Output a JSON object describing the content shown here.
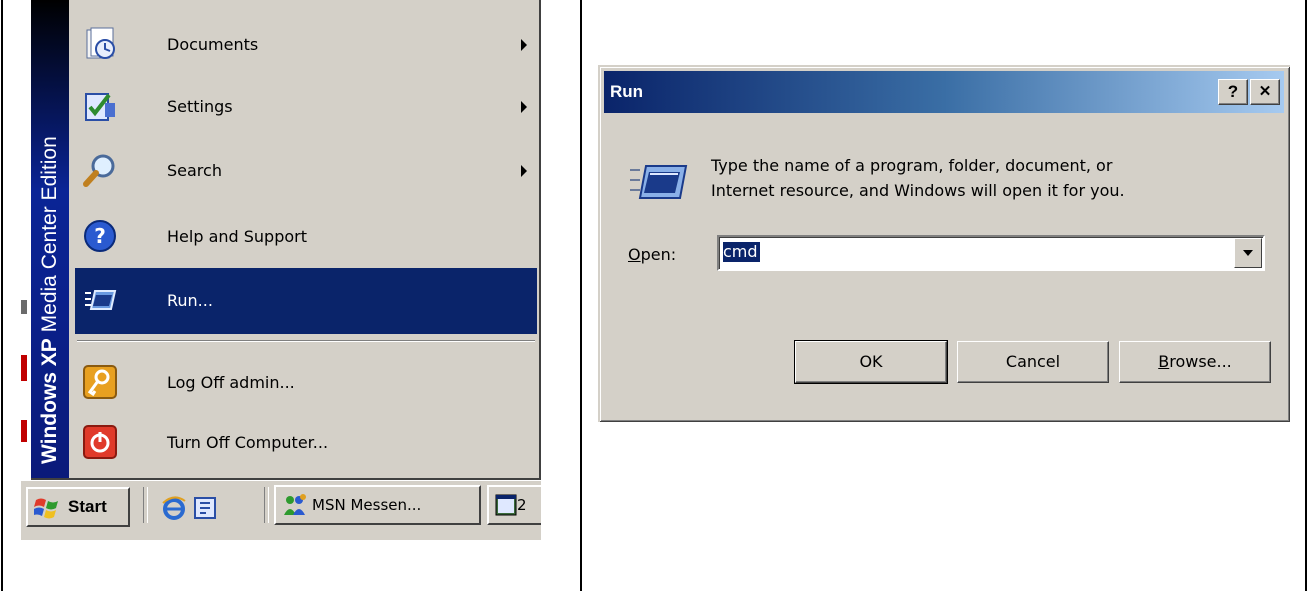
{
  "start_menu": {
    "banner_bold": "Windows XP",
    "banner_rest": " Media Center Edition",
    "items": [
      {
        "label": "Documents",
        "icon": "documents-icon",
        "submenu": true
      },
      {
        "label": "Settings",
        "icon": "settings-icon",
        "submenu": true
      },
      {
        "label": "Search",
        "icon": "search-icon",
        "submenu": true
      },
      {
        "label": "Help and Support",
        "icon": "help-icon",
        "submenu": false
      },
      {
        "label": "Run...",
        "icon": "run-icon",
        "submenu": false,
        "selected": true
      },
      {
        "label": "Log Off admin...",
        "icon": "log-off-icon",
        "submenu": false
      },
      {
        "label": "Turn Off Computer...",
        "icon": "power-icon",
        "submenu": false
      }
    ]
  },
  "taskbar": {
    "start_label": "Start",
    "quick_launch": [
      "internet-explorer-icon",
      "desktop-icon"
    ],
    "tasks": [
      {
        "label": "MSN Messen...",
        "icon": "msn-messenger-icon"
      },
      {
        "label": "2",
        "icon": "window-icon"
      }
    ]
  },
  "run_dialog": {
    "title": "Run",
    "help_button": "?",
    "close_button": "✕",
    "message_line1": "Type the name of a program, folder, document, or",
    "message_line2": "Internet resource, and Windows will open it for you.",
    "open_label_accel": "O",
    "open_label_rest": "pen:",
    "open_value": "cmd",
    "ok_label": "OK",
    "cancel_label": "Cancel",
    "browse_accel": "B",
    "browse_rest": "rowse..."
  },
  "colors": {
    "selection": "#0a246a",
    "face": "#d4d0c8"
  }
}
